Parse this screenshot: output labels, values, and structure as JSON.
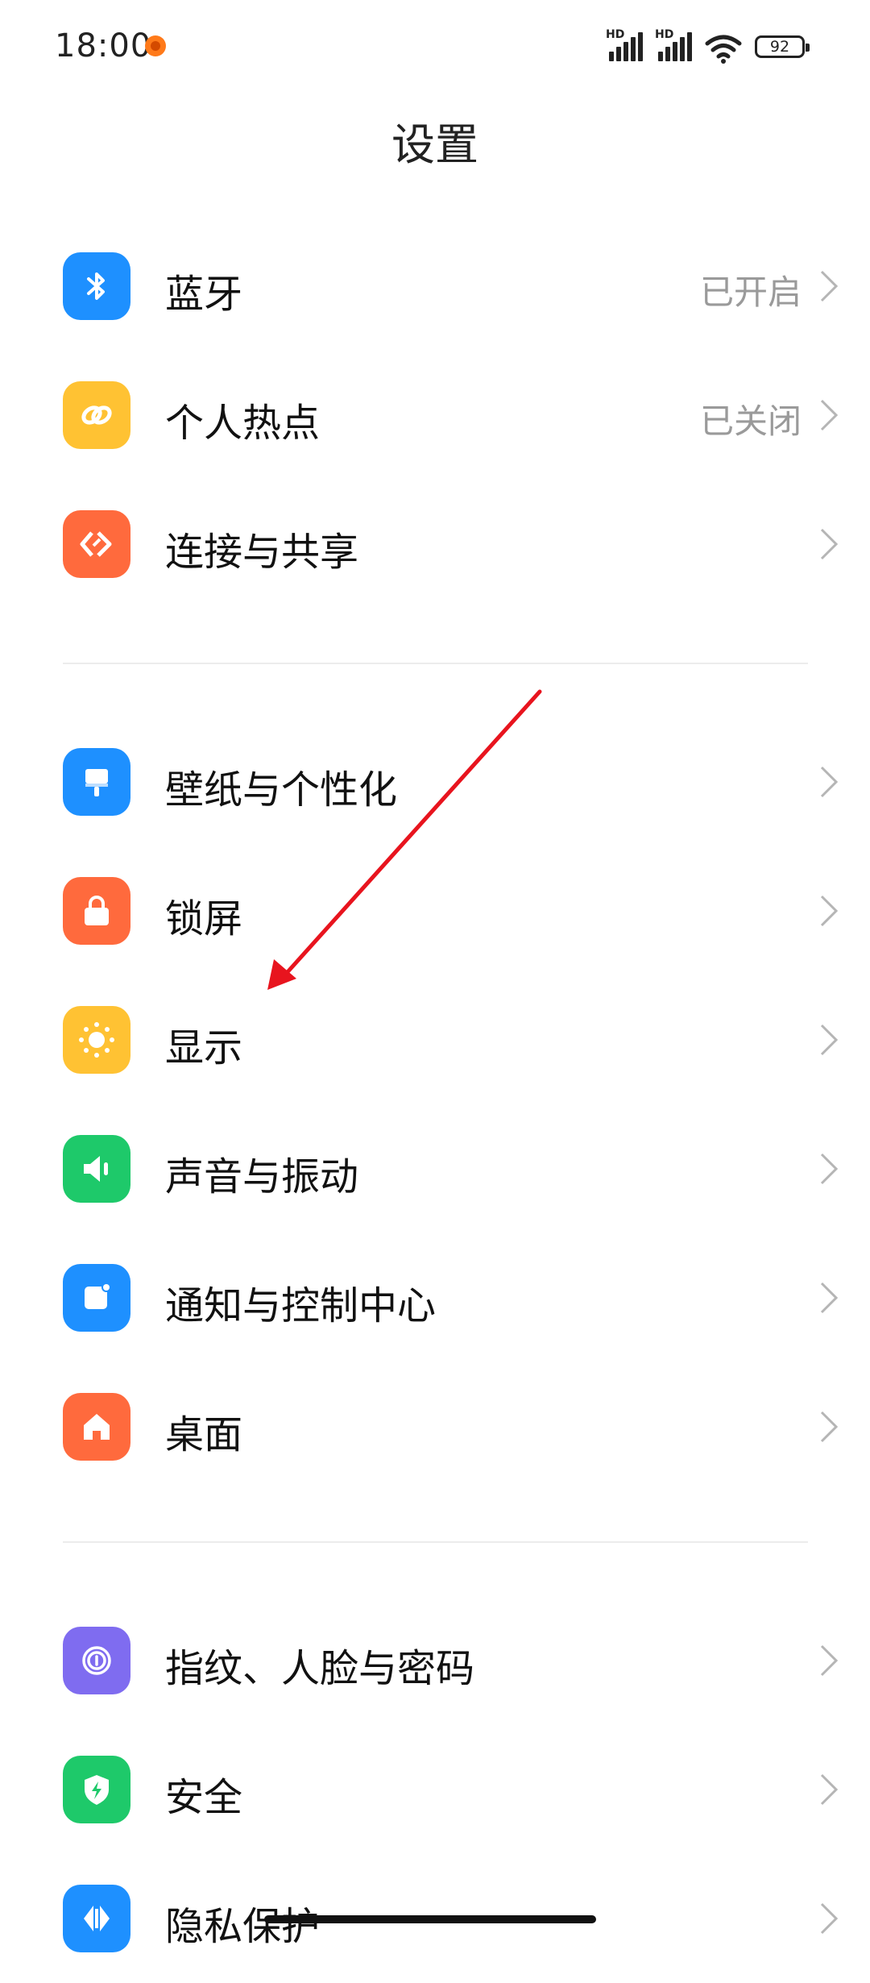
{
  "status_bar": {
    "time": "18:00",
    "signal1": "HD",
    "signal2": "HD",
    "battery": "92"
  },
  "header": {
    "title": "设置"
  },
  "groups": [
    [
      {
        "label": "蓝牙",
        "value": "已开启",
        "icon": "bluetooth-icon",
        "color": "#1e90ff"
      },
      {
        "label": "个人热点",
        "value": "已关闭",
        "icon": "hotspot-icon",
        "color": "#ffc233"
      },
      {
        "label": "连接与共享",
        "value": "",
        "icon": "share-icon",
        "color": "#ff6a3d"
      }
    ],
    [
      {
        "label": "壁纸与个性化",
        "value": "",
        "icon": "wallpaper-icon",
        "color": "#1e90ff"
      },
      {
        "label": "锁屏",
        "value": "",
        "icon": "lock-icon",
        "color": "#ff6a3d"
      },
      {
        "label": "显示",
        "value": "",
        "icon": "brightness-icon",
        "color": "#ffc233"
      },
      {
        "label": "声音与振动",
        "value": "",
        "icon": "speaker-icon",
        "color": "#1ec96a"
      },
      {
        "label": "通知与控制中心",
        "value": "",
        "icon": "notification-icon",
        "color": "#1e90ff"
      },
      {
        "label": "桌面",
        "value": "",
        "icon": "home-icon",
        "color": "#ff6a3d"
      }
    ],
    [
      {
        "label": "指纹、人脸与密码",
        "value": "",
        "icon": "fingerprint-icon",
        "color": "#7f6cf0"
      },
      {
        "label": "安全",
        "value": "",
        "icon": "shield-icon",
        "color": "#1ec96a"
      },
      {
        "label": "隐私保护",
        "value": "",
        "icon": "privacy-icon",
        "color": "#1e90ff"
      }
    ]
  ],
  "annotation": {
    "color": "#e8141e"
  }
}
